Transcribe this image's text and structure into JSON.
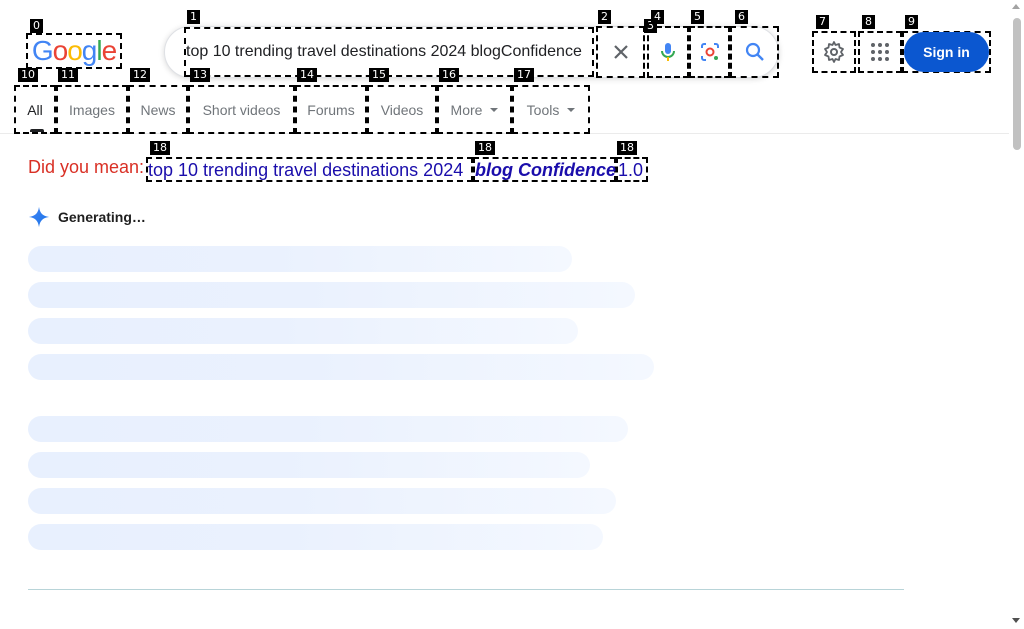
{
  "logo": {
    "letters": [
      {
        "ch": "G",
        "color": "#4285f4"
      },
      {
        "ch": "o",
        "color": "#ea4335"
      },
      {
        "ch": "o",
        "color": "#fbbc05"
      },
      {
        "ch": "g",
        "color": "#4285f4"
      },
      {
        "ch": "l",
        "color": "#34a853"
      },
      {
        "ch": "e",
        "color": "#ea4335"
      }
    ]
  },
  "search": {
    "query": "top 10 trending travel destinations 2024 blogConfidence"
  },
  "header": {
    "signin_label": "Sign in"
  },
  "tabs": [
    {
      "label": "All",
      "active": true
    },
    {
      "label": "Images"
    },
    {
      "label": "News"
    },
    {
      "label": "Short videos"
    },
    {
      "label": "Forums"
    },
    {
      "label": "Videos"
    },
    {
      "label": "More",
      "dropdown": true
    },
    {
      "label": "Tools",
      "dropdown": true
    }
  ],
  "spelling": {
    "prefix": "Did you mean:",
    "parts": [
      "top 10 trending travel destinations 2024",
      "blog Confidence",
      "1.0"
    ]
  },
  "ai_overview": {
    "status": "Generating…"
  },
  "annotation_labels": [
    "0",
    "1",
    "2",
    "3",
    "4",
    "5",
    "6",
    "7",
    "8",
    "9",
    "10",
    "11",
    "12",
    "13",
    "14",
    "15",
    "16",
    "17",
    "18",
    "18",
    "18"
  ],
  "colors": {
    "accent": "#0b57d0",
    "link": "#1a0dab",
    "did_you_mean": "#d93025",
    "gemini": "#4285f4"
  }
}
